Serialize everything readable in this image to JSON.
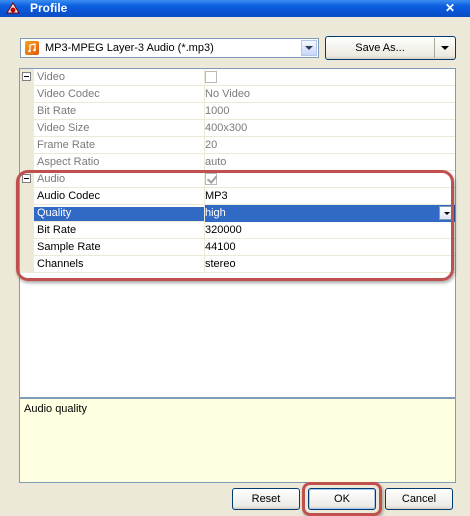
{
  "window": {
    "title": "Profile",
    "close_glyph": "✕"
  },
  "profile": {
    "selected": "MP3-MPEG Layer-3 Audio (*.mp3)",
    "icon": "mp3-file-icon",
    "save_as_label": "Save As..."
  },
  "grid": {
    "video": {
      "label": "Video",
      "enabled": false,
      "rows": [
        {
          "name": "Video Codec",
          "value": "No Video"
        },
        {
          "name": "Bit Rate",
          "value": "1000"
        },
        {
          "name": "Video Size",
          "value": "400x300"
        },
        {
          "name": "Frame Rate",
          "value": "20"
        },
        {
          "name": "Aspect Ratio",
          "value": "auto"
        }
      ]
    },
    "audio": {
      "label": "Audio",
      "enabled": true,
      "rows": [
        {
          "name": "Audio Codec",
          "value": "MP3"
        },
        {
          "name": "Quality",
          "value": "high"
        },
        {
          "name": "Bit Rate",
          "value": "320000"
        },
        {
          "name": "Sample Rate",
          "value": "44100"
        },
        {
          "name": "Channels",
          "value": "stereo"
        }
      ]
    }
  },
  "description": "Audio quality",
  "buttons": {
    "reset": "Reset",
    "ok": "OK",
    "cancel": "Cancel"
  },
  "colors": {
    "highlight_frame": "#c0504d",
    "selection": "#316ac5",
    "description_bg": "#ffffe1"
  }
}
